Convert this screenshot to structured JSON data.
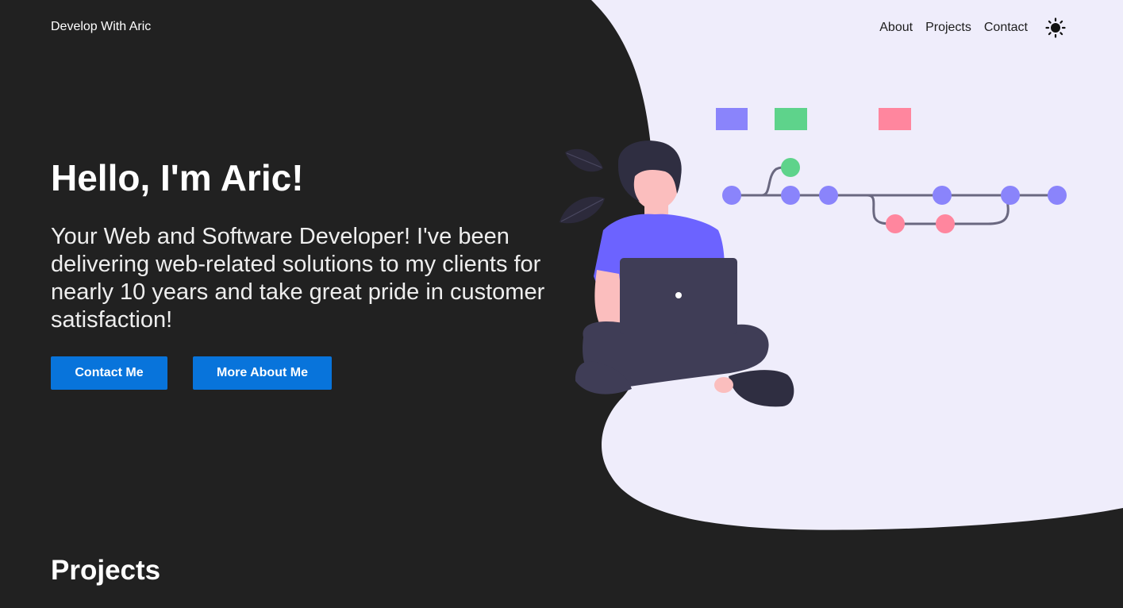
{
  "header": {
    "brand": "Develop With Aric",
    "nav": [
      "About",
      "Projects",
      "Contact"
    ],
    "theme_icon": "sun-icon"
  },
  "hero": {
    "title": "Hello, I'm Aric!",
    "subtitle": "Your Web and Software Developer! I've been delivering web-related solutions to my clients for nearly 10 years and take great pride in customer satisfaction!",
    "buttons": {
      "contact": "Contact Me",
      "about": "More About Me"
    },
    "illustration_icon": "developer-with-laptop-illustration"
  },
  "projects": {
    "title": "Projects"
  },
  "colors": {
    "background": "#212121",
    "blob": "#efedfb",
    "accent": "#0874db",
    "purple": "#8a84fb",
    "green": "#5ed38b",
    "pink": "#ff869e"
  }
}
